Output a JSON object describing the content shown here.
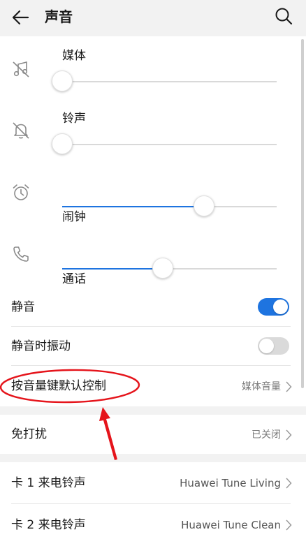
{
  "header": {
    "title": "声音",
    "back_icon": "back-arrow-icon",
    "search_icon": "search-icon"
  },
  "volume": {
    "media": {
      "label": "媒体",
      "icon": "music-muted-icon",
      "level": 0.0
    },
    "ringtone": {
      "label": "铃声",
      "icon": "bell-muted-icon",
      "level": 0.0
    },
    "alarm": {
      "label": "闹钟",
      "icon": "alarm-clock-icon",
      "level": 0.66
    },
    "call": {
      "label": "通话",
      "icon": "phone-icon",
      "level": 0.47
    }
  },
  "settings": {
    "mute": {
      "label": "静音",
      "on": true
    },
    "vibrate_when_muted": {
      "label": "静音时振动",
      "on": false
    },
    "volume_key_default": {
      "label": "按音量键默认控制",
      "value": "媒体音量"
    },
    "do_not_disturb": {
      "label": "免打扰",
      "value": "已关闭"
    },
    "sim1_ringtone": {
      "label": "卡 1 来电铃声",
      "value": "Huawei Tune Living"
    },
    "sim2_ringtone": {
      "label": "卡 2 来电铃声",
      "value": "Huawei Tune Clean"
    }
  },
  "colors": {
    "accent": "#1e74e0",
    "annotation": "#e5141b"
  }
}
